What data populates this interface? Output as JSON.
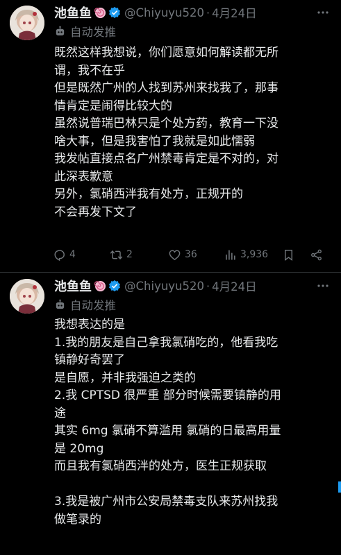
{
  "tweets": [
    {
      "display_name": "池鱼鱼",
      "handle": "@Chiyuyu520",
      "separator": "·",
      "date": "4月24日",
      "auto_label": "自动发推",
      "lines": [
        "既然这样我想说，你们愿意如何解读都无所",
        "谓，我不在乎",
        "但是既然广州的人找到苏州来找我了，那事",
        "情肯定是闹得比较大的",
        "虽然说普瑞巴林只是个处方药，教育一下没",
        "啥大事，但是我害怕了我就是如此懦弱",
        "我发帖直接点名广州禁毒肯定是不对的，对",
        "此深表歉意",
        "另外，氯硝西泮我有处方，正规开的",
        "不会再发下文了"
      ],
      "stats": {
        "replies": "4",
        "retweets": "2",
        "likes": "36",
        "views": "3,936"
      }
    },
    {
      "display_name": "池鱼鱼",
      "handle": "@Chiyuyu520",
      "separator": "·",
      "date": "4月24日",
      "auto_label": "自动发推",
      "lines": [
        "我想表达的是",
        "1.我的朋友是自己拿我氯硝吃的，他看我吃",
        "镇静好奇罢了",
        "是自愿，并非我强迫之类的",
        "2.我 CPTSD 很严重 部分时候需要镇静的用",
        "途",
        "其实 6mg 氯硝不算滥用 氯硝的日最高用量",
        "是 20mg",
        "而且我有氯硝西泮的处方，医生正规获取",
        "",
        "3.我是被广州市公安局禁毒支队来苏州找我",
        "做笔录的"
      ]
    }
  ],
  "colors": {
    "background": "#000000",
    "text": "#e7e9ea",
    "secondary": "#71767b",
    "verified": "#1d9bf0",
    "divider": "#2f3336"
  },
  "icons": [
    "avatar",
    "lollipop-emoji-icon",
    "verified-badge-icon",
    "more-icon",
    "robot-icon",
    "reply-icon",
    "retweet-icon",
    "like-icon",
    "views-icon",
    "bookmark-icon",
    "share-icon"
  ]
}
